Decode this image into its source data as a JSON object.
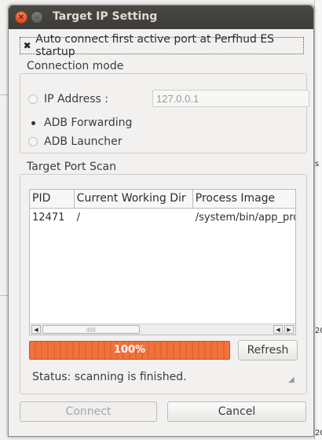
{
  "window": {
    "title": "Target IP Setting",
    "close_glyph": "✕",
    "minimize_glyph": "–"
  },
  "autoconnect": {
    "label": "Auto connect first active port at Perfhud ES startup",
    "checked": true,
    "check_glyph": "✖"
  },
  "connection_mode": {
    "title": "Connection mode",
    "options": [
      {
        "label": "IP Address :",
        "selected": false
      },
      {
        "label": "ADB Forwarding",
        "selected": true
      },
      {
        "label": "ADB Launcher",
        "selected": false
      }
    ],
    "ip_value": "127.0.0.1"
  },
  "port_scan": {
    "title": "Target Port Scan",
    "columns": [
      "PID",
      "Current Working Dir",
      "Process Image"
    ],
    "rows": [
      [
        "12471",
        "/",
        "/system/bin/app_process"
      ]
    ]
  },
  "progress": {
    "value": 100,
    "text": "100%"
  },
  "refresh_label": "Refresh",
  "status_text": "Status: scanning is finished.",
  "connect_label": "Connect",
  "cancel_label": "Cancel",
  "background": {
    "mark1": "s",
    "mark2": "20",
    "mark3": "20"
  },
  "colors": {
    "progress_fill": "#f0733d",
    "titlebar": "#3c3b37",
    "close_button": "#e0471f"
  }
}
